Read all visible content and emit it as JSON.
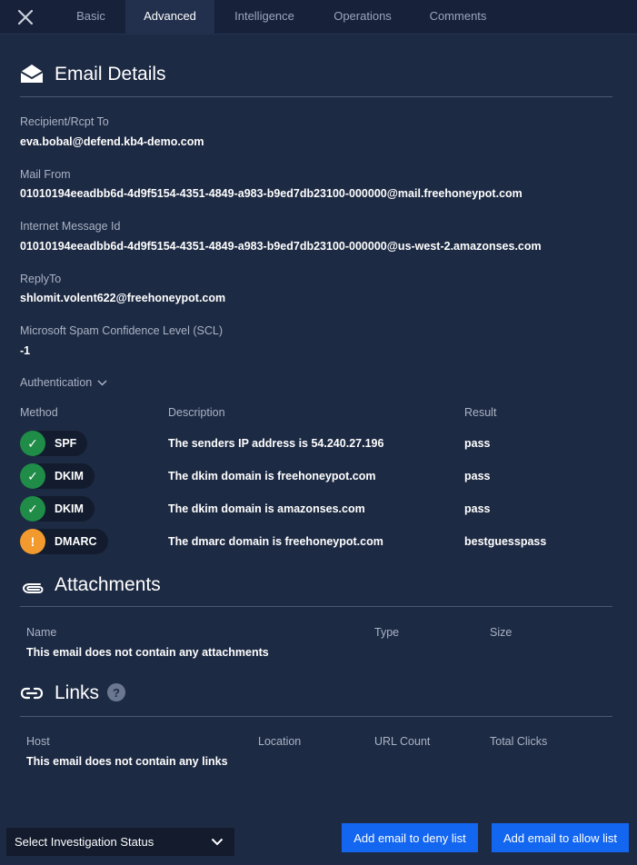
{
  "tabs": [
    {
      "label": "Basic"
    },
    {
      "label": "Advanced"
    },
    {
      "label": "Intelligence"
    },
    {
      "label": "Operations"
    },
    {
      "label": "Comments"
    }
  ],
  "email_details": {
    "title": "Email Details",
    "fields": [
      {
        "label": "Recipient/Rcpt To",
        "value": "eva.bobal@defend.kb4-demo.com"
      },
      {
        "label": "Mail From",
        "value": "01010194eeadbb6d-4d9f5154-4351-4849-a983-b9ed7db23100-000000@mail.freehoneypot.com"
      },
      {
        "label": "Internet Message Id",
        "value": "01010194eeadbb6d-4d9f5154-4351-4849-a983-b9ed7db23100-000000@us-west-2.amazonses.com"
      },
      {
        "label": "ReplyTo",
        "value": "shlomit.volent622@freehoneypot.com"
      },
      {
        "label": "Microsoft Spam Confidence Level (SCL)",
        "value": "-1"
      }
    ]
  },
  "authentication": {
    "toggle_label": "Authentication",
    "headers": {
      "method": "Method",
      "description": "Description",
      "result": "Result"
    },
    "rows": [
      {
        "status": "ok",
        "symbol": "✓",
        "method": "SPF",
        "description": "The senders IP address is 54.240.27.196",
        "result": "pass"
      },
      {
        "status": "ok",
        "symbol": "✓",
        "method": "DKIM",
        "description": "The dkim domain is freehoneypot.com",
        "result": "pass"
      },
      {
        "status": "ok",
        "symbol": "✓",
        "method": "DKIM",
        "description": "The dkim domain is amazonses.com",
        "result": "pass"
      },
      {
        "status": "warn",
        "symbol": "!",
        "method": "DMARC",
        "description": "The dmarc domain is freehoneypot.com",
        "result": "bestguesspass"
      }
    ]
  },
  "attachments": {
    "title": "Attachments",
    "headers": {
      "name": "Name",
      "type": "Type",
      "size": "Size"
    },
    "empty": "This email does not contain any attachments"
  },
  "links": {
    "title": "Links",
    "help": "?",
    "headers": {
      "host": "Host",
      "location": "Location",
      "url_count": "URL Count",
      "total_clicks": "Total Clicks"
    },
    "empty": "This email does not contain any links"
  },
  "footer": {
    "status_select": "Select Investigation Status",
    "deny_button": "Add email to deny list",
    "allow_button": "Add email to allow list"
  },
  "colors": {
    "background": "#1d2a43",
    "topbar": "#17223a",
    "accent_button": "#1366f0",
    "status_ok": "#1f8c48",
    "status_warn": "#f39a2e"
  }
}
